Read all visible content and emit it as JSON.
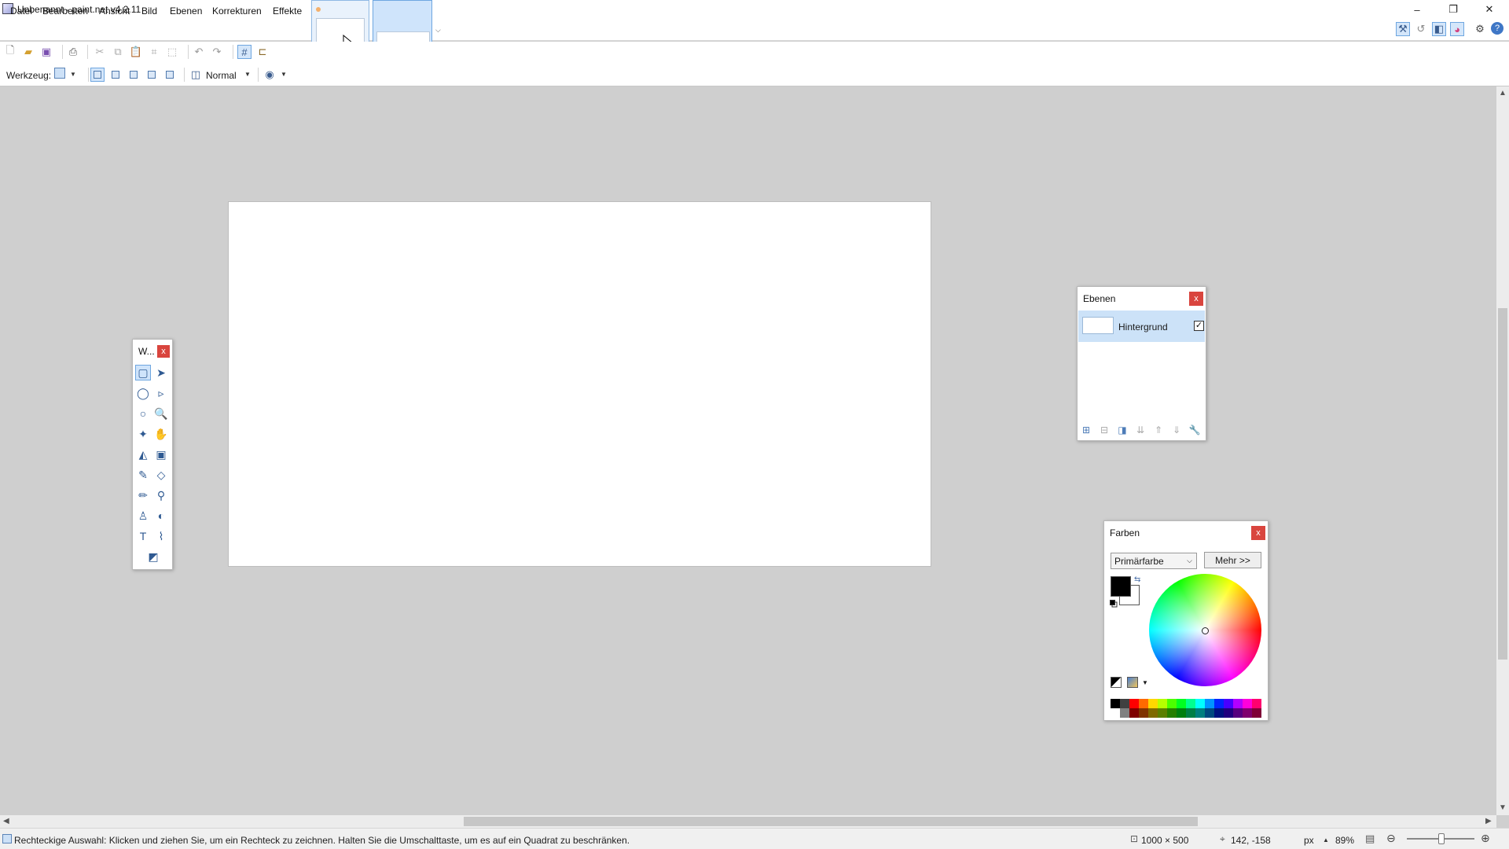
{
  "window": {
    "title": "Unbenannt - paint.net v4.2.11",
    "controls": {
      "minimize": "–",
      "maximize": "❐",
      "close": "✕"
    }
  },
  "menu": {
    "items": [
      "Datei",
      "Bearbeiten",
      "Ansicht",
      "Bild",
      "Ebenen",
      "Korrekturen",
      "Effekte"
    ]
  },
  "toolbar2": {
    "tool_label": "Werkzeug:",
    "blend_mode": "Normal"
  },
  "tools_window": {
    "title": "W...",
    "close": "x",
    "tools": [
      {
        "name": "rect-select-tool",
        "glyph": "▢"
      },
      {
        "name": "move-selection-tool",
        "glyph": "➤"
      },
      {
        "name": "lasso-select-tool",
        "glyph": "◯"
      },
      {
        "name": "move-selected-tool",
        "glyph": "▹"
      },
      {
        "name": "ellipse-select-tool",
        "glyph": "○"
      },
      {
        "name": "zoom-tool",
        "glyph": "🔍"
      },
      {
        "name": "magic-wand-tool",
        "glyph": "✦"
      },
      {
        "name": "pan-tool",
        "glyph": "✋"
      },
      {
        "name": "paint-bucket-tool",
        "glyph": "◭"
      },
      {
        "name": "gradient-tool",
        "glyph": "▣"
      },
      {
        "name": "paintbrush-tool",
        "glyph": "✎"
      },
      {
        "name": "eraser-tool",
        "glyph": "◇"
      },
      {
        "name": "pencil-tool",
        "glyph": "✏"
      },
      {
        "name": "color-picker-tool",
        "glyph": "⚲"
      },
      {
        "name": "clone-stamp-tool",
        "glyph": "♙"
      },
      {
        "name": "recolor-tool",
        "glyph": "◐"
      },
      {
        "name": "text-tool",
        "glyph": "T"
      },
      {
        "name": "line-curve-tool",
        "glyph": "⌇"
      },
      {
        "name": "shapes-tool",
        "glyph": "◩"
      }
    ]
  },
  "layers_window": {
    "title": "Ebenen",
    "close": "x",
    "layer_name": "Hintergrund",
    "visible_mark": "✓"
  },
  "colors_window": {
    "title": "Farben",
    "close": "x",
    "mode": "Primärfarbe",
    "more": "Mehr >>",
    "primary_color": "#000000",
    "secondary_color": "#ffffff",
    "palette_top": [
      "#000000",
      "#404040",
      "#ff0000",
      "#ff6a00",
      "#ffd800",
      "#b6ff00",
      "#4cff00",
      "#00ff21",
      "#00ff90",
      "#00ffff",
      "#0094ff",
      "#0026ff",
      "#4800ff",
      "#b200ff",
      "#ff00dc",
      "#ff006e"
    ],
    "palette_bottom": [
      "#ffffff",
      "#808080",
      "#7f0000",
      "#7f3300",
      "#7f6a00",
      "#5b7f00",
      "#267f00",
      "#007f0e",
      "#007f46",
      "#007f7f",
      "#004a7f",
      "#00137f",
      "#21007f",
      "#57007f",
      "#7f006e",
      "#7f0037"
    ]
  },
  "status": {
    "hint": "Rechteckige Auswahl: Klicken und ziehen Sie, um ein Rechteck zu zeichnen. Halten Sie die Umschalttaste, um es auf ein Quadrat zu beschränken.",
    "image_size": "1000 × 500",
    "cursor_pos": "142, -158",
    "unit": "px",
    "zoom": "89%"
  }
}
